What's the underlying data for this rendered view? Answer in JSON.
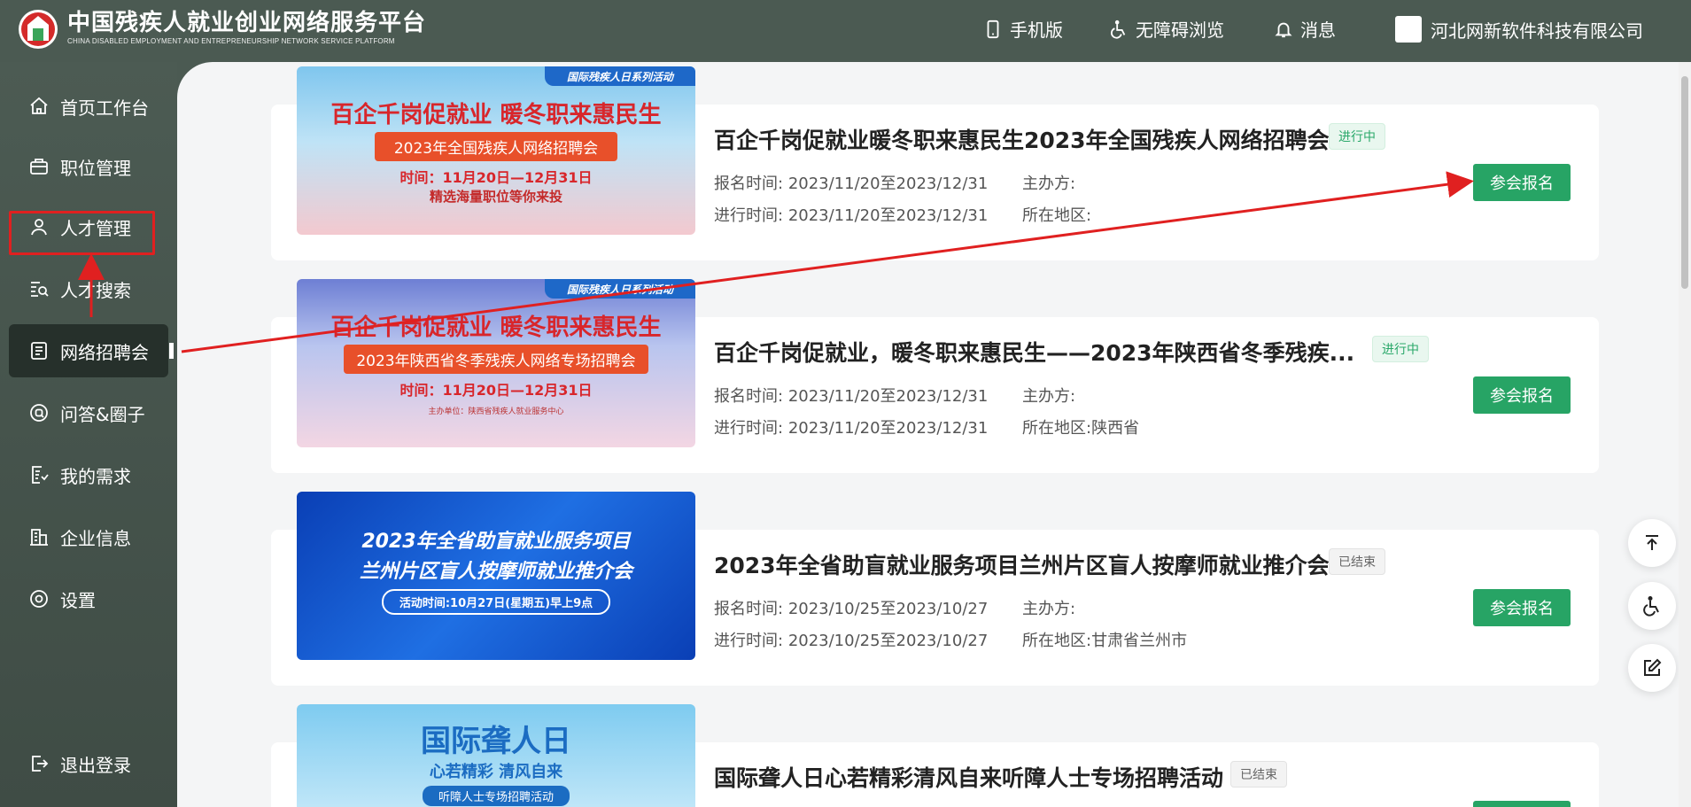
{
  "header": {
    "brand_cn": "中国残疾人就业创业网络服务平台",
    "brand_en": "CHINA DISABLED EMPLOYMENT AND ENTREPRENEURSHIP NETWORK SERVICE PLATFORM",
    "mobile": "手机版",
    "accessible": "无障碍浏览",
    "messages": "消息",
    "company": "河北网新软件科技有限公司"
  },
  "sidebar": {
    "items": [
      {
        "label": "首页工作台",
        "icon": "home-icon"
      },
      {
        "label": "职位管理",
        "icon": "briefcase-icon"
      },
      {
        "label": "人才管理",
        "icon": "user-icon"
      },
      {
        "label": "人才搜索",
        "icon": "search-list-icon"
      },
      {
        "label": "网络招聘会",
        "icon": "document-icon"
      },
      {
        "label": "问答&圈子",
        "icon": "qa-icon"
      },
      {
        "label": "我的需求",
        "icon": "list-icon"
      },
      {
        "label": "企业信息",
        "icon": "building-icon"
      },
      {
        "label": "设置",
        "icon": "settings-icon"
      }
    ],
    "active": "网络招聘会",
    "logout": "退出登录"
  },
  "fairs": [
    {
      "title": "百企千岗促就业暖冬职来惠民生2023年全国残疾人网络招聘会",
      "status": "进行中",
      "reg_label": "报名时间:",
      "reg_time": "2023/11/20至2023/12/31",
      "run_label": "进行时间:",
      "run_time": "2023/11/20至2023/12/31",
      "host_label": "主办方:",
      "host": "",
      "region_label": "所在地区:",
      "region": "",
      "button": "参会报名",
      "banner": {
        "ribbon": "国际残疾人日系列活动",
        "line1": "百企千岗促就业  暖冬职来惠民生",
        "line2": "2023年全国残疾人网络招聘会",
        "line3": "时间：11月20日—12月31日",
        "line4": "精选海量职位等你来投"
      }
    },
    {
      "title": "百企千岗促就业，暖冬职来惠民生——2023年陕西省冬季残疾...",
      "status": "进行中",
      "reg_label": "报名时间:",
      "reg_time": "2023/11/20至2023/12/31",
      "run_label": "进行时间:",
      "run_time": "2023/11/20至2023/12/31",
      "host_label": "主办方:",
      "host": "",
      "region_label": "所在地区:",
      "region": "陕西省",
      "button": "参会报名",
      "banner": {
        "ribbon": "国际残疾人日系列活动",
        "line1": "百企千岗促就业  暖冬职来惠民生",
        "line2": "2023年陕西省冬季残疾人网络专场招聘会",
        "line3": "时间：11月20日—12月31日",
        "line4": "主办单位：陕西省残疾人就业服务中心"
      }
    },
    {
      "title": "2023年全省助盲就业服务项目兰州片区盲人按摩师就业推介会",
      "status": "已结束",
      "reg_label": "报名时间:",
      "reg_time": "2023/10/25至2023/10/27",
      "run_label": "进行时间:",
      "run_time": "2023/10/25至2023/10/27",
      "host_label": "主办方:",
      "host": "",
      "region_label": "所在地区:",
      "region": "甘肃省兰州市",
      "button": "参会报名",
      "banner": {
        "line1": "2023年全省助盲就业服务项目",
        "line2": "兰州片区盲人按摩师就业推介会",
        "line3": "活动时间:10月27日(星期五)早上9点"
      }
    },
    {
      "title": "国际聋人日心若精彩清风自来听障人士专场招聘活动",
      "status": "已结束",
      "banner": {
        "line1": "国际聋人日",
        "line2": "心若精彩  清风自来",
        "line3": "听障人士专场招聘活动"
      }
    }
  ],
  "colors": {
    "sidebar_bg": "#4b5a52",
    "active_bg": "#26302b",
    "button_green": "#27a465",
    "annotation_red": "#e02020"
  }
}
